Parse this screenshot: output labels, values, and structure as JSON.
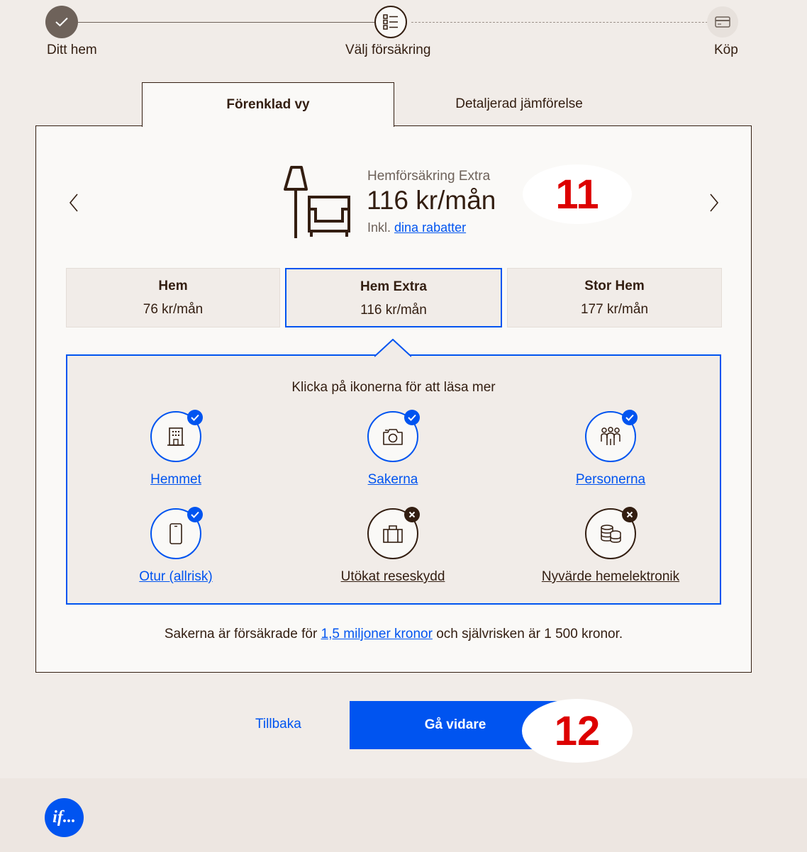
{
  "stepper": {
    "steps": [
      {
        "label": "Ditt hem",
        "state": "done"
      },
      {
        "label": "Välj försäkring",
        "state": "current"
      },
      {
        "label": "Köp",
        "state": "upcoming"
      }
    ]
  },
  "tabs": {
    "simple": "Förenklad vy",
    "detailed": "Detaljerad jämförelse"
  },
  "product": {
    "name": "Hemförsäkring Extra",
    "price": "116 kr/mån",
    "discount_prefix": "Inkl.",
    "discount_link": "dina rabatter"
  },
  "plans": [
    {
      "name": "Hem",
      "price": "76 kr/mån"
    },
    {
      "name": "Hem Extra",
      "price": "116 kr/mån",
      "selected": true
    },
    {
      "name": "Stor Hem",
      "price": "177 kr/mån"
    }
  ],
  "coverage": {
    "hint": "Klicka på ikonerna för att läsa mer",
    "items": [
      {
        "label": "Hemmet",
        "included": true,
        "icon": "building-icon"
      },
      {
        "label": "Sakerna",
        "included": true,
        "icon": "camera-icon"
      },
      {
        "label": "Personerna",
        "included": true,
        "icon": "people-icon"
      },
      {
        "label": "Otur (allrisk)",
        "included": true,
        "icon": "phone-icon"
      },
      {
        "label": "Utökat reseskydd",
        "included": false,
        "icon": "suitcase-icon"
      },
      {
        "label": "Nyvärde hemelektronik",
        "included": false,
        "icon": "coins-icon"
      }
    ]
  },
  "summary": {
    "prefix": "Sakerna är försäkrade för",
    "link": "1,5 miljoner kronor",
    "suffix": "och självrisken är 1 500 kronor."
  },
  "actions": {
    "back": "Tillbaka",
    "continue": "Gå vidare"
  },
  "annotations": {
    "badge_11": "11",
    "badge_12": "12"
  },
  "footer": {
    "logo_text": "if..."
  },
  "colors": {
    "accent": "#0054f0",
    "text": "#331e11",
    "background": "#f1ece8",
    "card": "#faf9f7",
    "annotation": "#dd0000"
  }
}
